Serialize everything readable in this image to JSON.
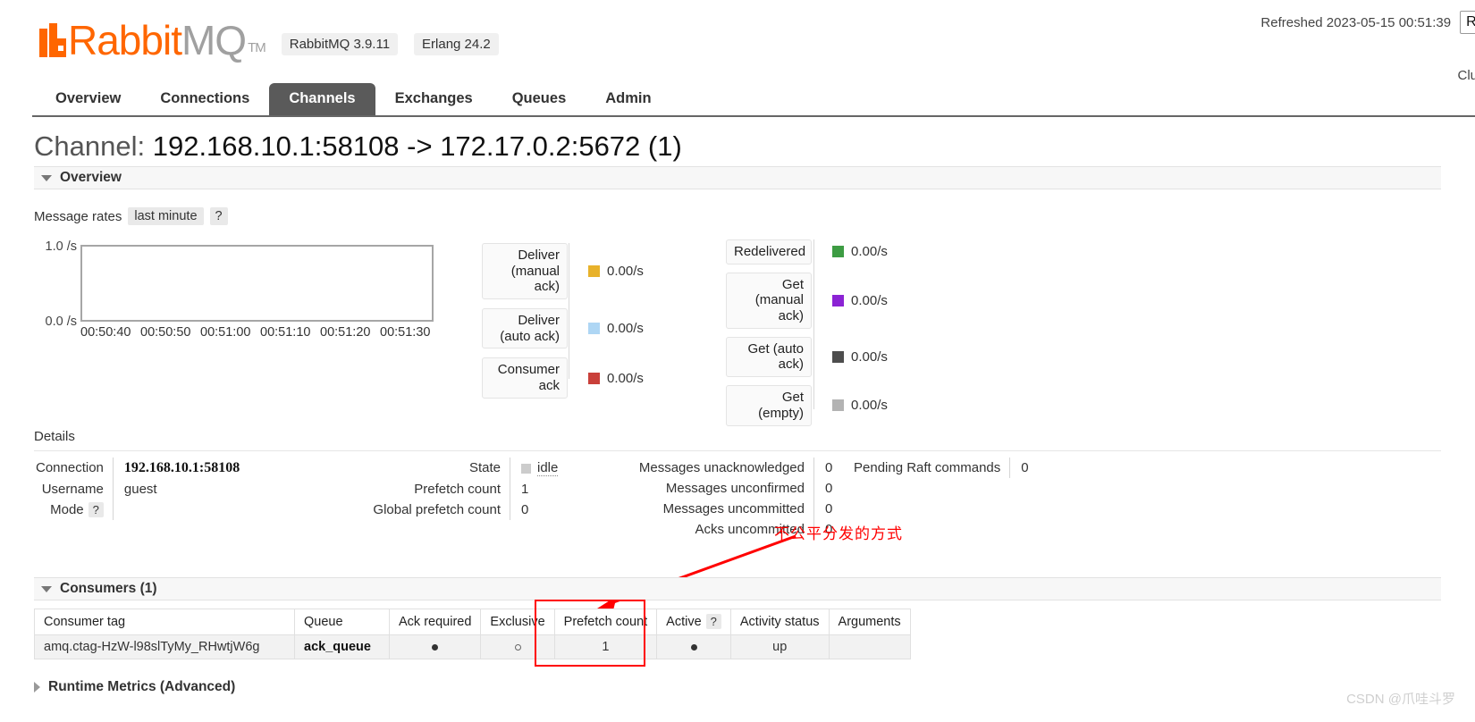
{
  "header": {
    "refreshed_text": "Refreshed 2023-05-15 00:51:39",
    "refresh_button": "Ref",
    "cluster_label": "Cluster",
    "logo_rabbit": "Rabbit",
    "logo_mq": "MQ",
    "logo_tm": "TM",
    "version_rabbitmq": "RabbitMQ 3.9.11",
    "version_erlang": "Erlang 24.2"
  },
  "nav": {
    "items": [
      {
        "label": "Overview",
        "active": false
      },
      {
        "label": "Connections",
        "active": false
      },
      {
        "label": "Channels",
        "active": true
      },
      {
        "label": "Exchanges",
        "active": false
      },
      {
        "label": "Queues",
        "active": false
      },
      {
        "label": "Admin",
        "active": false
      }
    ]
  },
  "page": {
    "title_label": "Channel:",
    "title_value": "192.168.10.1:58108 -> 172.17.0.2:5672 (1)",
    "overview_section": "Overview",
    "details_label": "Details",
    "consumers_section": "Consumers (1)",
    "bottom_section": "Runtime Metrics (Advanced)"
  },
  "message_rates": {
    "label": "Message rates",
    "period": "last minute",
    "help": "?"
  },
  "chart_data": {
    "type": "line",
    "title": "Message rates",
    "xlabel": "",
    "ylabel": "/s",
    "ylim": [
      0.0,
      1.0
    ],
    "ytick_labels": [
      "1.0 /s",
      "0.0 /s"
    ],
    "x": [
      "00:50:40",
      "00:50:50",
      "00:51:00",
      "00:51:10",
      "00:51:20",
      "00:51:30"
    ],
    "grid": false,
    "legend_position": "right",
    "series": [
      {
        "name": "Deliver (manual ack)",
        "rate": "0.00/s",
        "color": "#e8b22b",
        "values": [
          0,
          0,
          0,
          0,
          0,
          0
        ]
      },
      {
        "name": "Deliver (auto ack)",
        "rate": "0.00/s",
        "color": "#aed6f4",
        "values": [
          0,
          0,
          0,
          0,
          0,
          0
        ]
      },
      {
        "name": "Consumer ack",
        "rate": "0.00/s",
        "color": "#c9403a",
        "values": [
          0,
          0,
          0,
          0,
          0,
          0
        ]
      },
      {
        "name": "Redelivered",
        "rate": "0.00/s",
        "color": "#3d9c43",
        "values": [
          0,
          0,
          0,
          0,
          0,
          0
        ]
      },
      {
        "name": "Get (manual ack)",
        "rate": "0.00/s",
        "color": "#8b23d4",
        "values": [
          0,
          0,
          0,
          0,
          0,
          0
        ]
      },
      {
        "name": "Get (auto ack)",
        "rate": "0.00/s",
        "color": "#4d4d4d",
        "values": [
          0,
          0,
          0,
          0,
          0,
          0
        ]
      },
      {
        "name": "Get (empty)",
        "rate": "0.00/s",
        "color": "#b3b3b3",
        "values": [
          0,
          0,
          0,
          0,
          0,
          0
        ]
      }
    ]
  },
  "details": {
    "left": [
      {
        "key": "Connection",
        "value": "192.168.10.1:58108",
        "strong": true
      },
      {
        "key": "Username",
        "value": "guest",
        "strong": false
      },
      {
        "key": "Mode",
        "value": "",
        "strong": false,
        "help": "?"
      }
    ],
    "mid": [
      {
        "key": "State",
        "value": "idle"
      },
      {
        "key": "Prefetch count",
        "value": "1"
      },
      {
        "key": "Global prefetch count",
        "value": "0"
      }
    ],
    "right": [
      {
        "key": "Messages unacknowledged",
        "value": "0"
      },
      {
        "key": "Messages unconfirmed",
        "value": "0"
      },
      {
        "key": "Messages uncommitted",
        "value": "0"
      },
      {
        "key": "Acks uncommitted",
        "value": "0"
      }
    ],
    "far_right": [
      {
        "key": "Pending Raft commands",
        "value": "0"
      }
    ]
  },
  "annotation": {
    "text": "不公平分发的方式",
    "color": "#ff0000"
  },
  "consumers_table": {
    "headers": [
      "Consumer tag",
      "Queue",
      "Ack required",
      "Exclusive",
      "Prefetch count",
      "Active",
      "Activity status",
      "Arguments"
    ],
    "active_help": "?",
    "rows": [
      {
        "consumer_tag": "amq.ctag-HzW-l98slTyMy_RHwtjW6g",
        "queue": "ack_queue",
        "ack_required": "●",
        "exclusive": "○",
        "prefetch_count": "1",
        "active": "●",
        "activity_status": "up",
        "arguments": ""
      }
    ]
  },
  "watermark": "CSDN @爪哇斗罗"
}
